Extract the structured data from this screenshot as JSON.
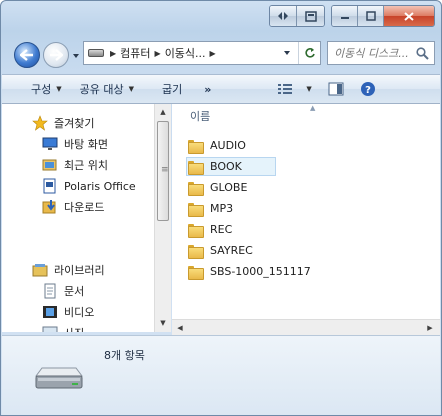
{
  "address": {
    "segments": [
      "컴퓨터",
      "이동식..."
    ]
  },
  "search": {
    "placeholder": "이동식 디스크..."
  },
  "toolbar": {
    "organize": "구성",
    "share": "공유 대상",
    "burn": "굽기",
    "more": "»"
  },
  "nav": {
    "favorites": "즐겨찾기",
    "favorite_items": [
      "바탕 화면",
      "최근 위치",
      "Polaris Office",
      "다운로드"
    ],
    "libraries": "라이브러리",
    "library_items": [
      "문서",
      "비디오",
      "사진"
    ]
  },
  "files": {
    "column_name": "이름",
    "items": [
      "AUDIO",
      "BOOK",
      "GLOBE",
      "MP3",
      "REC",
      "SAYREC",
      "SBS-1000_151117"
    ]
  },
  "details": {
    "count": "8개 항목"
  },
  "colors": {
    "selection": "#e5f3fb",
    "accent": "#1f4e9c",
    "folder": "#e9b94a"
  }
}
